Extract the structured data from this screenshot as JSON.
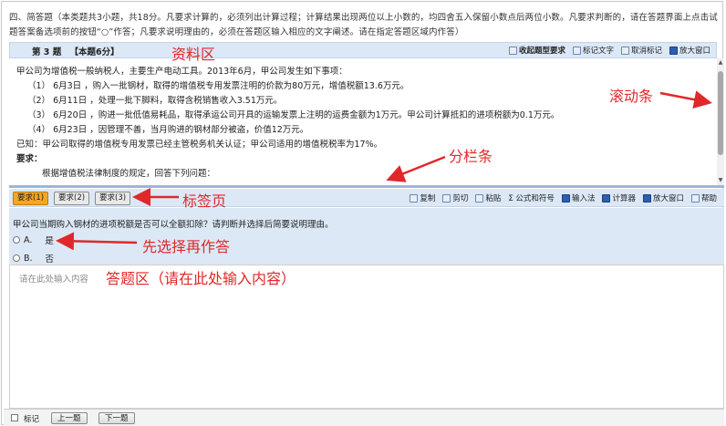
{
  "instructions": "四、简答题（本类题共3小题，共18分。凡要求计算的，必须列出计算过程；计算结果出现两位以上小数的，均四舍五入保留小数点后两位小数。凡要求判断的，请在答题界面上点击试题答案备选项前的按钮“○”作答；凡要求说明理由的，必须在答题区输入相应的文字阐述。请在指定答题区域内作答）",
  "question_header": {
    "number": "第 3 题",
    "score": "【本题6分】"
  },
  "question_tools": [
    "收起题型要求",
    "标记文字",
    "取消标记",
    "放大窗口"
  ],
  "material": {
    "lines": [
      "甲公司为增值税一般纳税人，主要生产电动工具。2013年6月，甲公司发生如下事项：",
      "（1）  6月3日 ，购入一批钢材，取得的增值税专用发票注明的价款为80万元，增值税额13.6万元。",
      "（2）  6月11日 ，处理一批下脚料，取得含税销售收入3.51万元。",
      "（3）  6月20日 ，购进一批低值易耗品，取得承运公司开具的运输发票上注明的运费金额为1万元。甲公司计算抵扣的进项税额为0.1万元。",
      "（4）  6月23日 ，因管理不善，当月购进的钢材部分被盗，价值12万元。",
      "已知：甲公司取得的增值税专用发票已经主管税务机关认证；甲公司适用的增值税税率为17%。",
      "要求：",
      "根据增值税法律制度的规定，回答下列问题："
    ]
  },
  "tabs": [
    "要求(1)",
    "要求(2)",
    "要求(3)"
  ],
  "answer_tools": [
    "复制",
    "剪切",
    "粘贴",
    "Σ 公式和符号",
    "输入法",
    "计算器",
    "放大窗口",
    "帮助"
  ],
  "sub_question": "甲公司当期购入钢材的进项税额是否可以全额扣除？请判断并选择后简要说明理由。",
  "options": [
    {
      "letter": "A.",
      "text": "是"
    },
    {
      "letter": "B.",
      "text": "否"
    }
  ],
  "answer_placeholder": "请在此处输入内容",
  "annotations": {
    "material_zone": "资料区",
    "scrollbar": "滚动条",
    "splitter": "分栏条",
    "tabs": "标签页",
    "choose_first": "先选择再作答",
    "answer_zone": "答题区（请在此处输入内容）"
  },
  "footer": {
    "mark": "标记",
    "prev": "上一题",
    "next": "下一题"
  },
  "colors": {
    "annotation": "#e0282b",
    "panel": "#dce8f6",
    "active_tab": "#f6a524",
    "splitter": "#9ab6de"
  }
}
